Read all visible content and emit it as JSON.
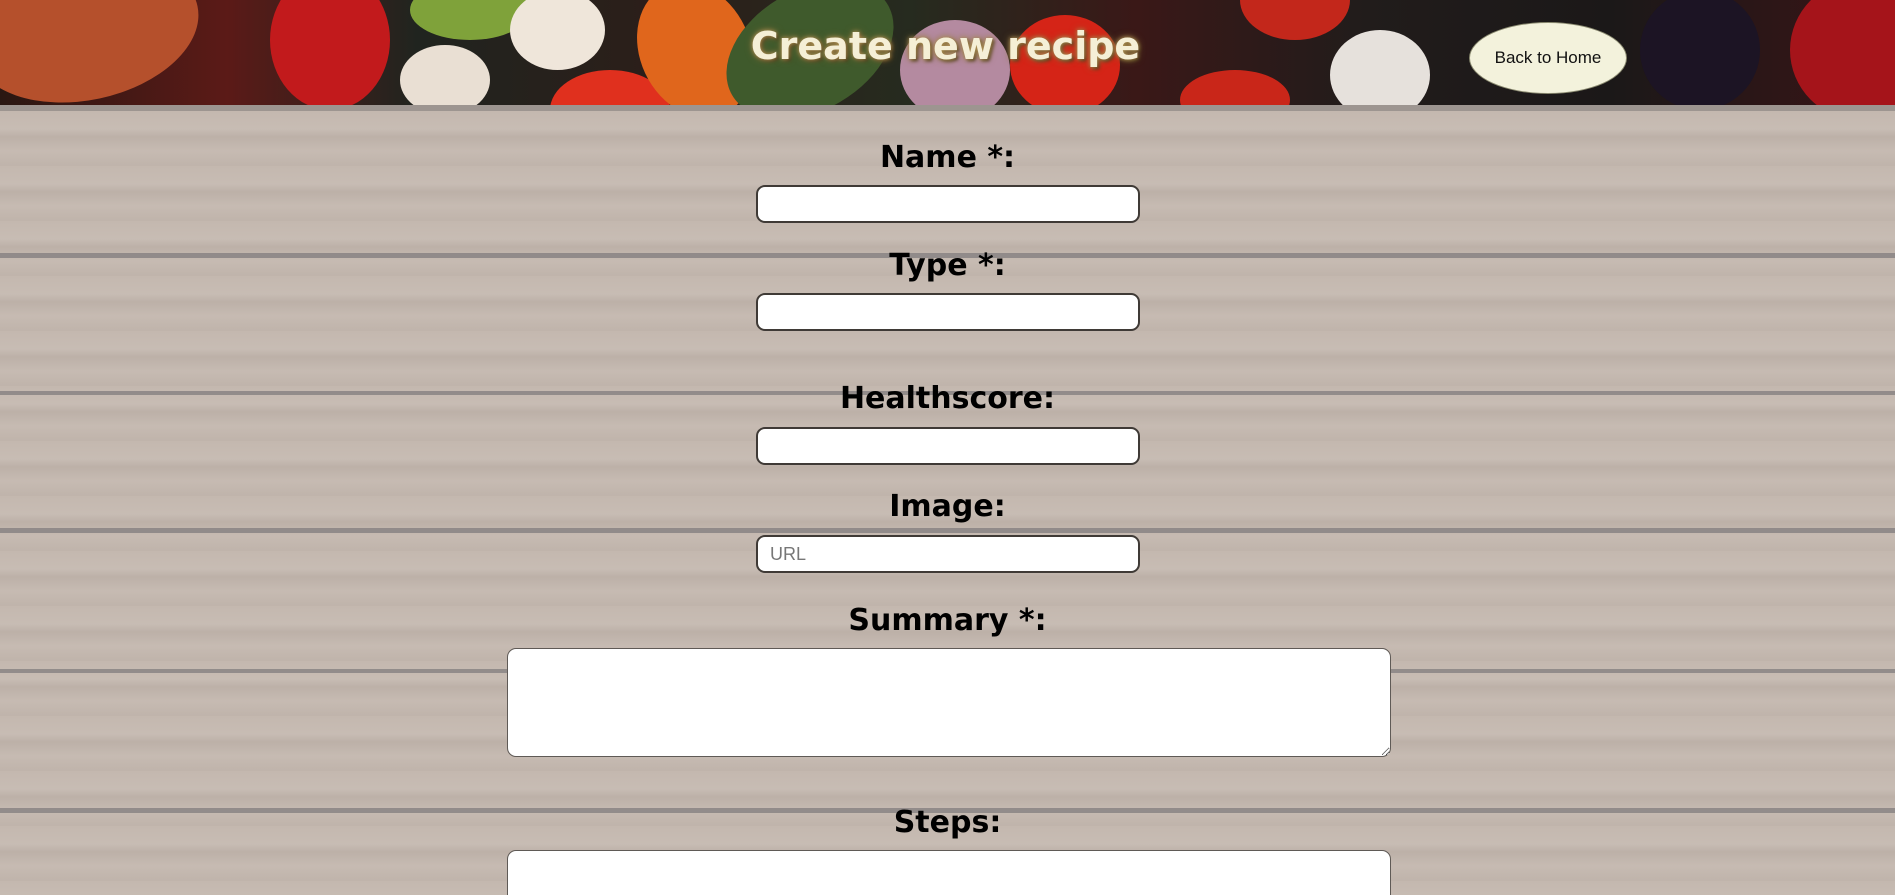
{
  "header": {
    "title": "Create new recipe",
    "back_label": "Back to Home"
  },
  "form": {
    "name_label": "Name *:",
    "type_label": "Type *:",
    "healthscore_label": "Healthscore:",
    "image_label": "Image:",
    "image_placeholder": "URL",
    "summary_label": "Summary *:",
    "steps_label": "Steps:"
  },
  "colors": {
    "title_text": "#f5efd6",
    "back_button_bg": "#f3f2dc",
    "background_wood": "#c4b8af"
  }
}
